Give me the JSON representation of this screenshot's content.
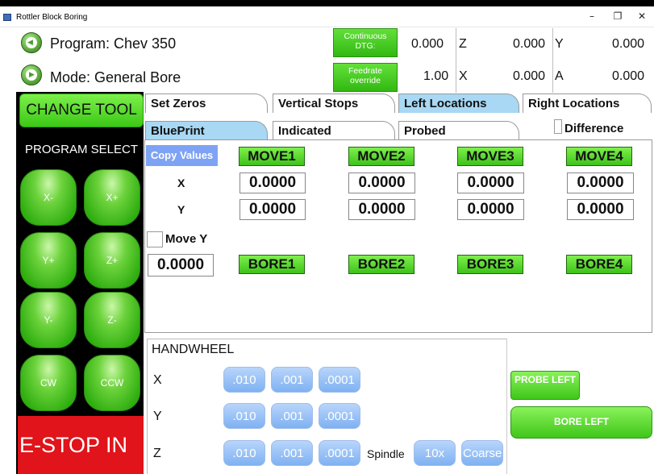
{
  "window": {
    "title": "Rottler Block Boring",
    "minimize": "–",
    "restore": "❐",
    "close": "✕"
  },
  "header": {
    "program_label": "Program: Chev 350",
    "mode_label": "Mode: General Bore",
    "continuous_btn": "Continuous DTG:",
    "feedrate_btn": "Feedrate override",
    "dtg_value": "0.000",
    "feedrate_value": "1.00",
    "readouts": [
      {
        "axis": "Z",
        "value": "0.000"
      },
      {
        "axis": "Y",
        "value": "0.000"
      },
      {
        "axis": "X",
        "value": "0.000"
      },
      {
        "axis": "A",
        "value": "0.000"
      }
    ]
  },
  "left": {
    "change_tool": "CHANGE TOOL",
    "program_select": "PROGRAM SELECT",
    "jog": [
      "X-",
      "X+",
      "Y+",
      "Z+",
      "Y-",
      "Z-",
      "CW",
      "CCW"
    ],
    "estop": "E-STOP IN"
  },
  "tabs_row1": [
    "Set Zeros",
    "Vertical Stops",
    "Left Locations",
    "Right Locations"
  ],
  "tabs_row2": [
    "BluePrint",
    "Indicated",
    "Probed"
  ],
  "difference_label": "Difference",
  "main": {
    "copy_values": "Copy Values",
    "moves": [
      "MOVE1",
      "MOVE2",
      "MOVE3",
      "MOVE4"
    ],
    "x_label": "X",
    "y_label": "Y",
    "x_values": [
      "0.0000",
      "0.0000",
      "0.0000",
      "0.0000"
    ],
    "y_values": [
      "0.0000",
      "0.0000",
      "0.0000",
      "0.0000"
    ],
    "move_y_label": "Move Y",
    "move_y_value": "0.0000",
    "bores": [
      "BORE1",
      "BORE2",
      "BORE3",
      "BORE4"
    ]
  },
  "handwheel": {
    "title": "HANDWHEEL",
    "axes": [
      "X",
      "Y",
      "Z"
    ],
    "increments": [
      ".010",
      ".001",
      ".0001"
    ],
    "spindle_label": "Spindle",
    "spindle_btn": "10x",
    "coarse_btn": "Coarse"
  },
  "right": {
    "probe_left": "PROBE LEFT",
    "bore_left": "BORE LEFT"
  }
}
